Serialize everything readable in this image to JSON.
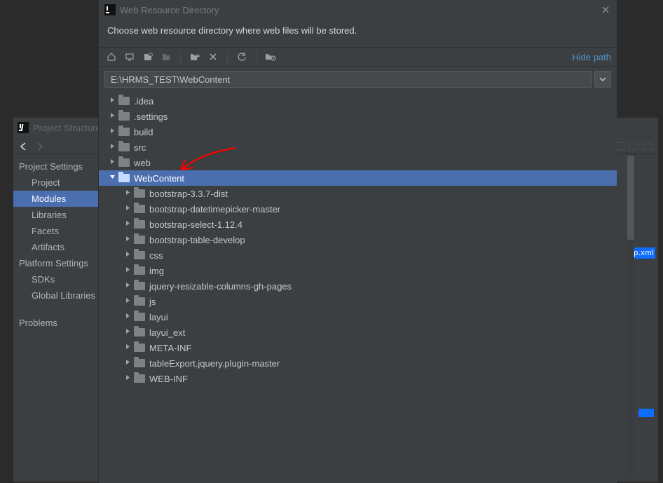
{
  "background": {
    "title": "Project Structure",
    "sections": [
      {
        "header": "Project Settings",
        "items": [
          "Project",
          "Modules",
          "Libraries",
          "Facets",
          "Artifacts"
        ],
        "selected": "Modules"
      },
      {
        "header": "Platform Settings",
        "items": [
          "SDKs",
          "Global Libraries"
        ]
      },
      {
        "header": "Problems",
        "items": []
      }
    ],
    "right_tag": "p.xml"
  },
  "dialog": {
    "title": "Web Resource Directory",
    "description": "Choose web resource directory where web files will be stored.",
    "hide_path": "Hide path",
    "path_value": "E:\\HRMS_TEST\\WebContent",
    "tree": [
      {
        "label": ".idea",
        "depth": 1,
        "expanded": false
      },
      {
        "label": ".settings",
        "depth": 1,
        "expanded": false
      },
      {
        "label": "build",
        "depth": 1,
        "expanded": false
      },
      {
        "label": "src",
        "depth": 1,
        "expanded": false
      },
      {
        "label": "web",
        "depth": 1,
        "expanded": false
      },
      {
        "label": "WebContent",
        "depth": 1,
        "expanded": true,
        "selected": true
      },
      {
        "label": "bootstrap-3.3.7-dist",
        "depth": 2,
        "expanded": false
      },
      {
        "label": "bootstrap-datetimepicker-master",
        "depth": 2,
        "expanded": false
      },
      {
        "label": "bootstrap-select-1.12.4",
        "depth": 2,
        "expanded": false
      },
      {
        "label": "bootstrap-table-develop",
        "depth": 2,
        "expanded": false
      },
      {
        "label": "css",
        "depth": 2,
        "expanded": false
      },
      {
        "label": "img",
        "depth": 2,
        "expanded": false
      },
      {
        "label": "jquery-resizable-columns-gh-pages",
        "depth": 2,
        "expanded": false
      },
      {
        "label": "js",
        "depth": 2,
        "expanded": false
      },
      {
        "label": "layui",
        "depth": 2,
        "expanded": false
      },
      {
        "label": "layui_ext",
        "depth": 2,
        "expanded": false
      },
      {
        "label": "META-INF",
        "depth": 2,
        "expanded": false
      },
      {
        "label": "tableExport.jquery.plugin-master",
        "depth": 2,
        "expanded": false
      },
      {
        "label": "WEB-INF",
        "depth": 2,
        "expanded": false
      }
    ]
  }
}
